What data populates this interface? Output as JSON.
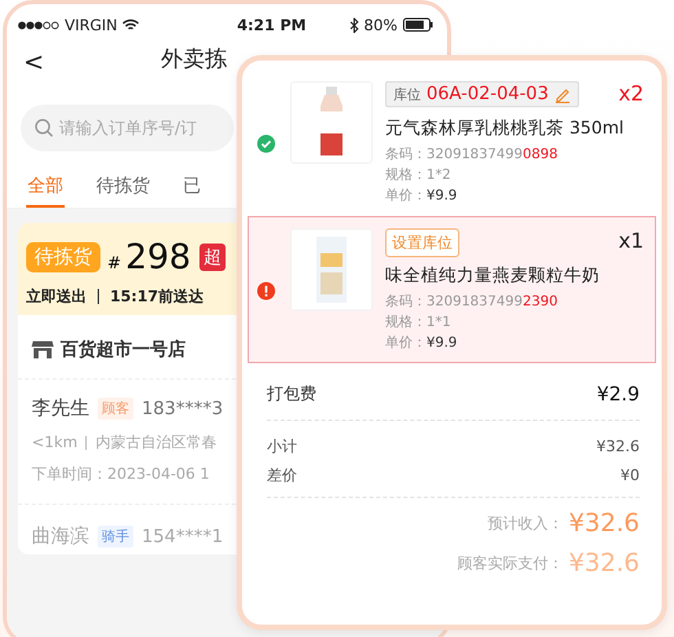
{
  "status_bar": {
    "carrier": "VIRGIN",
    "time": "4:21 PM",
    "battery": "80%"
  },
  "nav": {
    "back": "<",
    "title": "外卖拣"
  },
  "search": {
    "placeholder": "请输入订单序号/订"
  },
  "tabs": [
    {
      "label": "全部",
      "selected": true
    },
    {
      "label": "待拣货",
      "selected": false
    },
    {
      "label": "已",
      "selected": false
    }
  ],
  "order": {
    "status": "待拣货",
    "hash": "#",
    "number": "298",
    "badge": "超",
    "dispatch": "立即送出",
    "deadline": "15:17前送达",
    "store": "百货超市一号店",
    "contacts": [
      {
        "name": "李先生",
        "role": "顾客",
        "kind": "customer",
        "phone": "183****3"
      },
      {
        "name": "曲海滨",
        "role": "骑手",
        "kind": "rider",
        "phone": "154****1"
      }
    ],
    "distance": "<1km",
    "address": "内蒙古自治区常春",
    "order_time": "下单时间：2023-04-06 1"
  },
  "detail": {
    "items": [
      {
        "kind": "picked",
        "location_label": "库位",
        "location_code": "06A-02-04-03",
        "quantity": "x2",
        "name": "元气森林厚乳桃桃乳茶 350ml",
        "barcode_label": "条码：",
        "barcode_main": "32091837499",
        "barcode_tail": "0898",
        "spec": "规格：1*2",
        "price_label": "单价：",
        "price": "¥9.9"
      },
      {
        "kind": "unassigned",
        "set_location": "设置库位",
        "quantity": "x1",
        "name": "味全植纯力量燕麦颗粒牛奶",
        "barcode_label": "条码：",
        "barcode_main": "32091837499",
        "barcode_tail": "2390",
        "spec": "规格：1*1",
        "price_label": "单价：",
        "price": "¥9.9"
      }
    ],
    "fees": [
      {
        "kind": "fee",
        "label": "打包费",
        "value": "¥2.9"
      },
      {
        "kind": "plain",
        "label": "小计",
        "value": "¥32.6"
      },
      {
        "kind": "plain",
        "label": "差价",
        "value": "¥0"
      },
      {
        "kind": "income",
        "label": "预计收入：",
        "value": "¥32.6"
      },
      {
        "kind": "paid",
        "label": "顾客实际支付：",
        "value": "¥32.6"
      }
    ]
  }
}
